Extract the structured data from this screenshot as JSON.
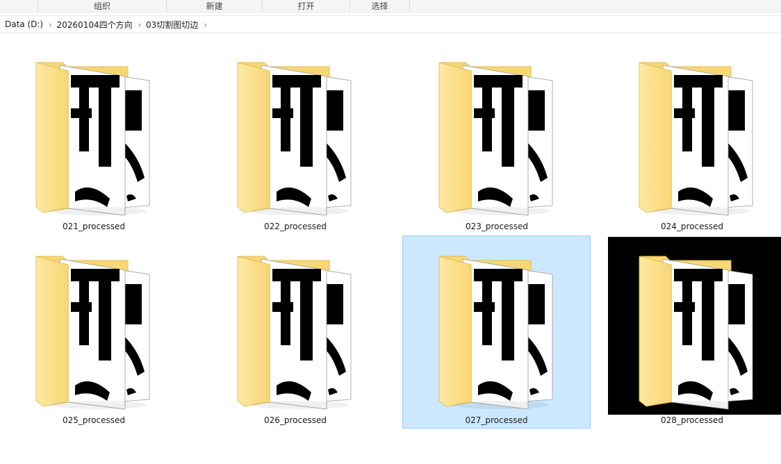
{
  "ribbon": {
    "groups": [
      "组织",
      "新建",
      "打开",
      "选择"
    ]
  },
  "breadcrumb": {
    "items": [
      "Data (D:)",
      "20260104四个方向",
      "03切割图切边"
    ]
  },
  "folders": [
    {
      "name": "021_processed",
      "state": "normal",
      "icon": "folder-thumbnail-icon"
    },
    {
      "name": "022_processed",
      "state": "normal",
      "icon": "folder-thumbnail-icon"
    },
    {
      "name": "023_processed",
      "state": "normal",
      "icon": "folder-thumbnail-icon"
    },
    {
      "name": "024_processed",
      "state": "normal",
      "icon": "folder-thumbnail-icon"
    },
    {
      "name": "025_processed",
      "state": "normal",
      "icon": "folder-thumbnail-icon"
    },
    {
      "name": "026_processed",
      "state": "normal",
      "icon": "folder-thumbnail-icon"
    },
    {
      "name": "027_processed",
      "state": "selected",
      "icon": "folder-thumbnail-icon"
    },
    {
      "name": "028_processed",
      "state": "highlighted-dark",
      "icon": "folder-thumbnail-icon"
    }
  ],
  "colors": {
    "selection_fill": "#cce8ff",
    "selection_border": "#99d1ff",
    "folder_yellow": "#f8d775",
    "folder_light": "#fde9a3"
  }
}
